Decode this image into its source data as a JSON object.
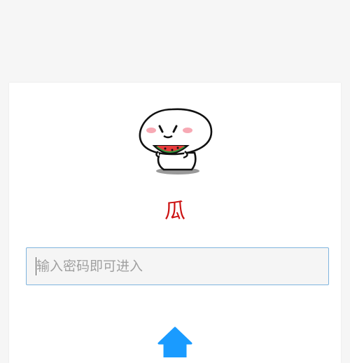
{
  "page": {
    "title": "瓜",
    "title_color": "#cc1111"
  },
  "password": {
    "value": "",
    "placeholder": "输入密码即可进入"
  },
  "mascot": {
    "icon": "watermelon-eating-mascot-icon"
  },
  "home_button": {
    "icon": "home-icon",
    "color": "#1a9bff"
  }
}
